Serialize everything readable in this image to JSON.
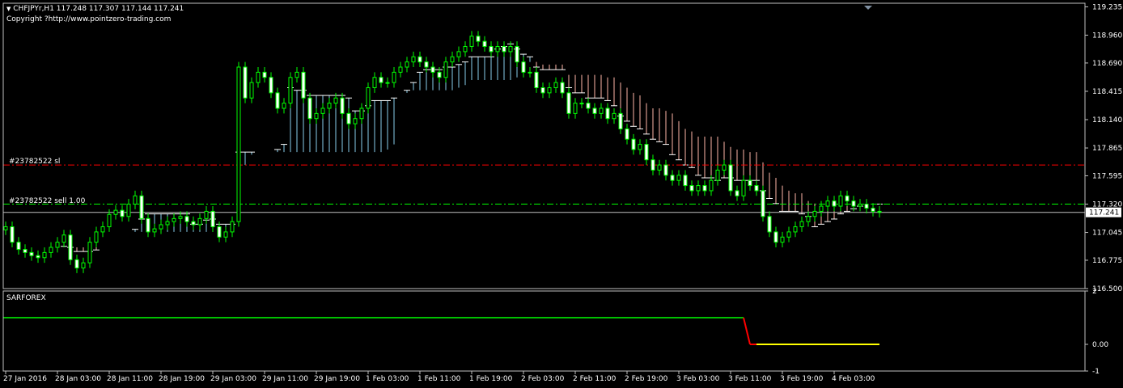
{
  "header": {
    "symbol_line": "CHFJPYr,H1  117.248 117.307 117.144 117.241",
    "copyright": "Copyright ?http://www.pointzero-trading.com"
  },
  "indicator": {
    "name": "SARFOREX"
  },
  "orders": {
    "sl_label": "#23782522 sl",
    "sell_label": "#23782522 sell 1.00",
    "sl_price": 117.7,
    "entry_price": 117.32
  },
  "colors": {
    "background": "#000000",
    "grid_frame": "#c0c0c0",
    "candle": "#00ff00",
    "candle_body_up": "#000000",
    "candle_body_down": "#ffffff",
    "cloud_bull": "#87ceeb",
    "cloud_bear": "#ffb6a8",
    "sl_line": "#ff0000",
    "entry_line": "#00ff00",
    "bid_line": "#c0c0c0",
    "ind_green": "#00c000",
    "ind_red": "#ff0000",
    "ind_yellow": "#ffff00"
  },
  "chart_data": [
    {
      "type": "candlestick",
      "symbol": "CHFJPYr",
      "timeframe": "H1",
      "ylim": [
        116.5,
        119.27
      ],
      "y_ticks": [
        "119.235",
        "118.960",
        "118.690",
        "118.415",
        "118.140",
        "117.865",
        "117.595",
        "117.320",
        "117.045",
        "116.775",
        "116.500"
      ],
      "current_price_label": "117.241",
      "x_ticks": [
        "27 Jan 2016",
        "28 Jan 03:00",
        "28 Jan 11:00",
        "28 Jan 19:00",
        "29 Jan 03:00",
        "29 Jan 11:00",
        "29 Jan 19:00",
        "1 Feb 03:00",
        "1 Feb 11:00",
        "1 Feb 19:00",
        "2 Feb 03:00",
        "2 Feb 11:00",
        "2 Feb 19:00",
        "3 Feb 03:00",
        "3 Feb 11:00",
        "3 Feb 19:00",
        "4 Feb 03:00"
      ],
      "bars_per_tick": 8,
      "closes": [
        117.1,
        116.95,
        116.88,
        116.85,
        116.82,
        116.8,
        116.85,
        116.9,
        116.95,
        117.02,
        116.78,
        116.7,
        116.75,
        116.95,
        117.05,
        117.1,
        117.22,
        117.26,
        117.2,
        117.32,
        117.4,
        117.18,
        117.05,
        117.08,
        117.12,
        117.15,
        117.18,
        117.2,
        117.15,
        117.12,
        117.18,
        117.25,
        117.1,
        117.0,
        117.05,
        117.15,
        118.65,
        118.35,
        118.5,
        118.6,
        118.55,
        118.4,
        118.25,
        118.3,
        118.55,
        118.6,
        118.35,
        118.15,
        118.2,
        118.25,
        118.3,
        118.35,
        118.2,
        118.1,
        118.15,
        118.25,
        118.45,
        118.55,
        118.5,
        118.5,
        118.6,
        118.65,
        118.7,
        118.75,
        118.7,
        118.65,
        118.6,
        118.55,
        118.7,
        118.75,
        118.8,
        118.85,
        118.95,
        118.9,
        118.85,
        118.8,
        118.85,
        118.8,
        118.85,
        118.7,
        118.6,
        118.6,
        118.45,
        118.4,
        118.45,
        118.5,
        118.4,
        118.2,
        118.3,
        118.3,
        118.25,
        118.2,
        118.25,
        118.15,
        118.2,
        118.05,
        117.95,
        117.85,
        117.9,
        117.75,
        117.65,
        117.7,
        117.6,
        117.55,
        117.6,
        117.5,
        117.45,
        117.5,
        117.45,
        117.55,
        117.65,
        117.7,
        117.45,
        117.4,
        117.55,
        117.5,
        117.45,
        117.2,
        117.05,
        116.95,
        117.0,
        117.05,
        117.1,
        117.15,
        117.2,
        117.25,
        117.3,
        117.35,
        117.3,
        117.4,
        117.35,
        117.3,
        117.32,
        117.28,
        117.25,
        117.24
      ]
    },
    {
      "type": "line",
      "name": "SARFOREX",
      "ylim": [
        -1,
        2
      ],
      "y_ticks": [
        "2",
        "0.00",
        "-1"
      ],
      "green_value": 1.0,
      "red_yellow_value": 0.0,
      "switch_bar": 114
    }
  ]
}
